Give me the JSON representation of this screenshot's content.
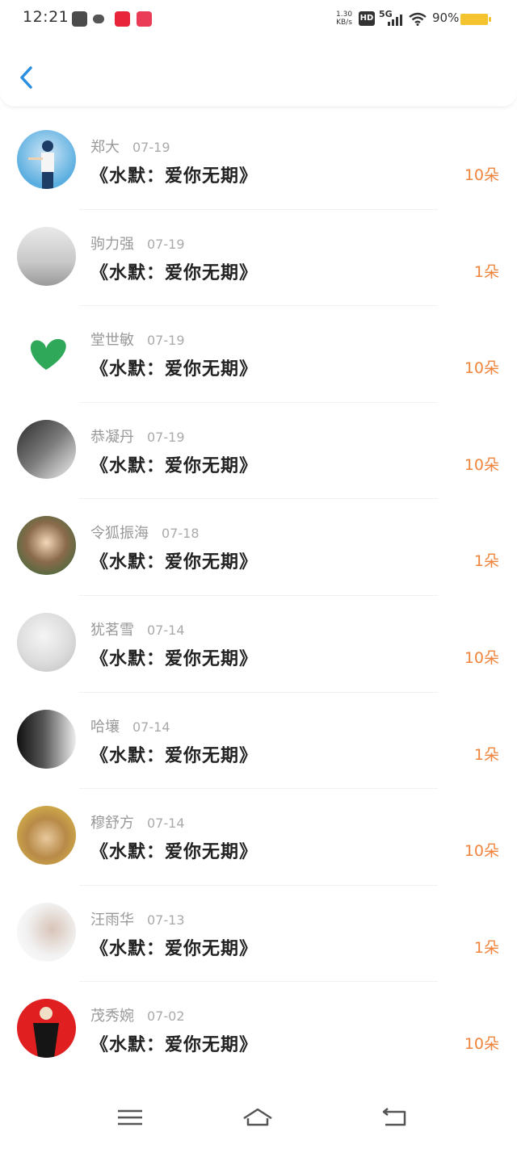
{
  "status_bar": {
    "time": "12:21",
    "net_speed_value": "1.30",
    "net_speed_unit": "KB/s",
    "hd_label": "HD",
    "network_label": "5G",
    "battery_percent": "90%"
  },
  "header": {
    "back_icon": "chevron-left-icon"
  },
  "colors": {
    "accent": "#2a8fe0",
    "count": "#f0843c",
    "name": "#999999"
  },
  "entries": [
    {
      "name": "郑大",
      "date": "07-19",
      "title": "《水默：爱你无期》",
      "count": "10朵"
    },
    {
      "name": "驹力强",
      "date": "07-19",
      "title": "《水默：爱你无期》",
      "count": "1朵"
    },
    {
      "name": "堂世敏",
      "date": "07-19",
      "title": "《水默：爱你无期》",
      "count": "10朵"
    },
    {
      "name": "恭凝丹",
      "date": "07-19",
      "title": "《水默：爱你无期》",
      "count": "10朵"
    },
    {
      "name": "令狐振海",
      "date": "07-18",
      "title": "《水默：爱你无期》",
      "count": "1朵"
    },
    {
      "name": "犹茗雪",
      "date": "07-14",
      "title": "《水默：爱你无期》",
      "count": "10朵"
    },
    {
      "name": "哈壤",
      "date": "07-14",
      "title": "《水默：爱你无期》",
      "count": "1朵"
    },
    {
      "name": "穆舒方",
      "date": "07-14",
      "title": "《水默：爱你无期》",
      "count": "10朵"
    },
    {
      "name": "汪雨华",
      "date": "07-13",
      "title": "《水默：爱你无期》",
      "count": "1朵"
    },
    {
      "name": "茂秀婉",
      "date": "07-02",
      "title": "《水默：爱你无期》",
      "count": "10朵"
    }
  ],
  "nav_bar": {
    "menu_icon": "menu-icon",
    "home_icon": "home-icon",
    "back_icon": "back-icon"
  }
}
